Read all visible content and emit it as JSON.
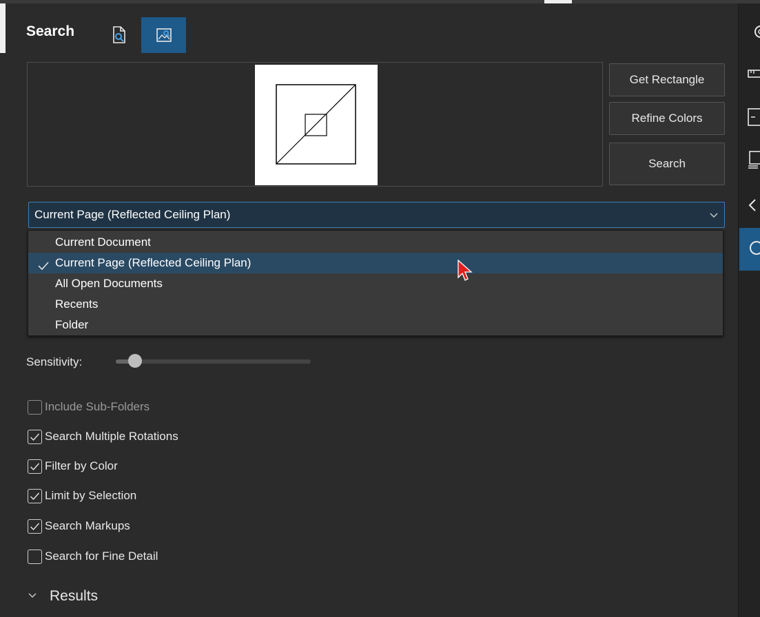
{
  "panel": {
    "title": "Search",
    "header_icons": [
      "text-search-icon",
      "image-search-icon"
    ],
    "active_mode": "image-search"
  },
  "buttons": {
    "get_rectangle": "Get Rectangle",
    "refine_colors": "Refine Colors",
    "search": "Search"
  },
  "scope": {
    "selected": "Current Page (Reflected Ceiling Plan)",
    "options": [
      {
        "label": "Current Document",
        "selected": false
      },
      {
        "label": "Current Page (Reflected Ceiling Plan)",
        "selected": true
      },
      {
        "label": "All Open Documents",
        "selected": false
      },
      {
        "label": "Recents",
        "selected": false
      },
      {
        "label": "Folder",
        "selected": false
      }
    ]
  },
  "sensitivity": {
    "label": "Sensitivity:",
    "value_fraction": 0.1
  },
  "options": [
    {
      "label": "Include Sub-Folders",
      "checked": false,
      "disabled": true
    },
    {
      "label": "Search Multiple Rotations",
      "checked": true,
      "disabled": false
    },
    {
      "label": "Filter by Color",
      "checked": true,
      "disabled": false
    },
    {
      "label": "Limit by Selection",
      "checked": true,
      "disabled": false
    },
    {
      "label": "Search Markups",
      "checked": true,
      "disabled": false
    },
    {
      "label": "Search for Fine Detail",
      "checked": false,
      "disabled": false
    }
  ],
  "results": {
    "label": "Results",
    "expanded": false
  },
  "colors": {
    "accent": "#1e5a8a",
    "panel_bg": "#2b2b2b",
    "selected_row": "#2a4a64"
  }
}
